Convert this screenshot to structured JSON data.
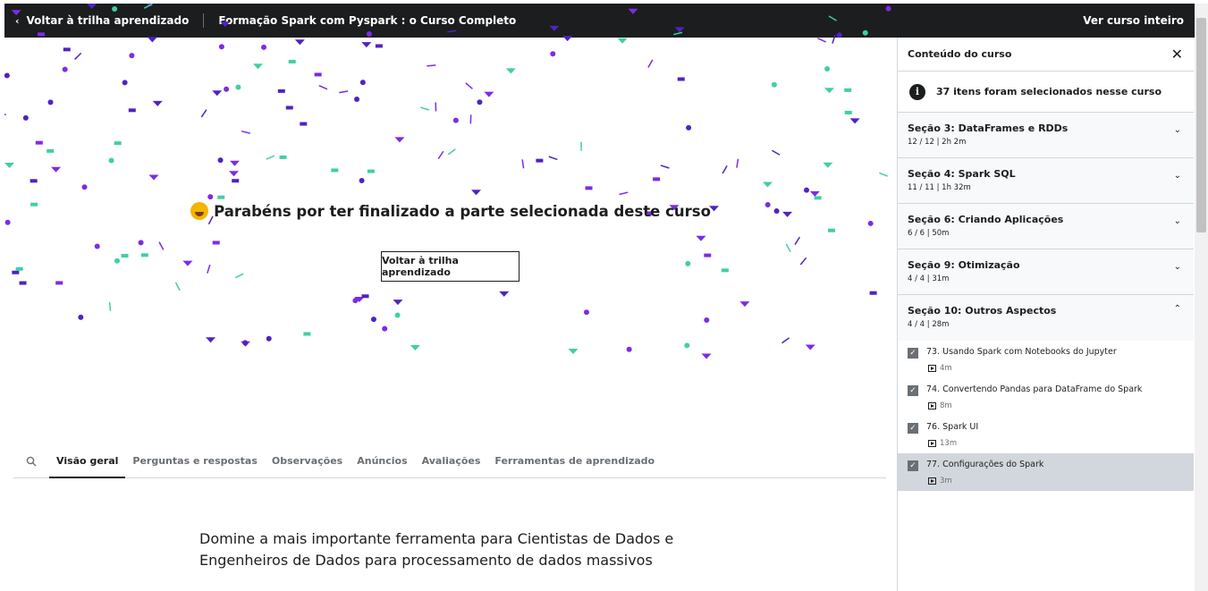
{
  "topbar": {
    "back_label": "Voltar à trilha aprendizado",
    "course_title": "Formação Spark com Pyspark : o Curso Completo",
    "full_course_label": "Ver curso inteiro"
  },
  "celebration": {
    "message": "Parabéns por ter finalizado a parte selecionada deste curso",
    "button_label": "Voltar à trilha aprendizado"
  },
  "tabs": [
    {
      "label": "Visão geral",
      "active": true
    },
    {
      "label": "Perguntas e respostas"
    },
    {
      "label": "Observações"
    },
    {
      "label": "Anúncios"
    },
    {
      "label": "Avaliações"
    },
    {
      "label": "Ferramentas de aprendizado"
    }
  ],
  "overview": {
    "line1": "Domine a mais importante ferramenta para Cientistas de Dados e",
    "line2": "Engenheiros de Dados para processamento de dados massivos"
  },
  "sidebar": {
    "title": "Conteúdo do curso",
    "info": "37 itens foram selecionados nesse curso",
    "sections": [
      {
        "title": "Seção 3: DataFrames e RDDs",
        "meta": "12 / 12 | 2h 2m",
        "expanded": false
      },
      {
        "title": "Seção 4: Spark SQL",
        "meta": "11 / 11 | 1h 32m",
        "expanded": false
      },
      {
        "title": "Seção 6: Criando Aplicações",
        "meta": "6 / 6 | 50m",
        "expanded": false
      },
      {
        "title": "Seção 9: Otimização",
        "meta": "4 / 4 | 31m",
        "expanded": false
      },
      {
        "title": "Seção 10: Outros Aspectos",
        "meta": "4 / 4 | 28m",
        "expanded": true
      }
    ],
    "lectures": [
      {
        "title": "73. Usando Spark com Notebooks do Jupyter",
        "duration": "4m",
        "active": false
      },
      {
        "title": "74. Convertendo Pandas para DataFrame do Spark",
        "duration": "8m",
        "active": false
      },
      {
        "title": "76. Spark UI",
        "duration": "13m",
        "active": false
      },
      {
        "title": "77. Configurações do Spark",
        "duration": "3m",
        "active": true
      }
    ]
  },
  "colors": {
    "confetti_purple": "#7d2ae8",
    "confetti_indigo": "#5022c3",
    "confetti_teal": "#3fcfa5",
    "topbar_bg": "#1c1d1f"
  }
}
